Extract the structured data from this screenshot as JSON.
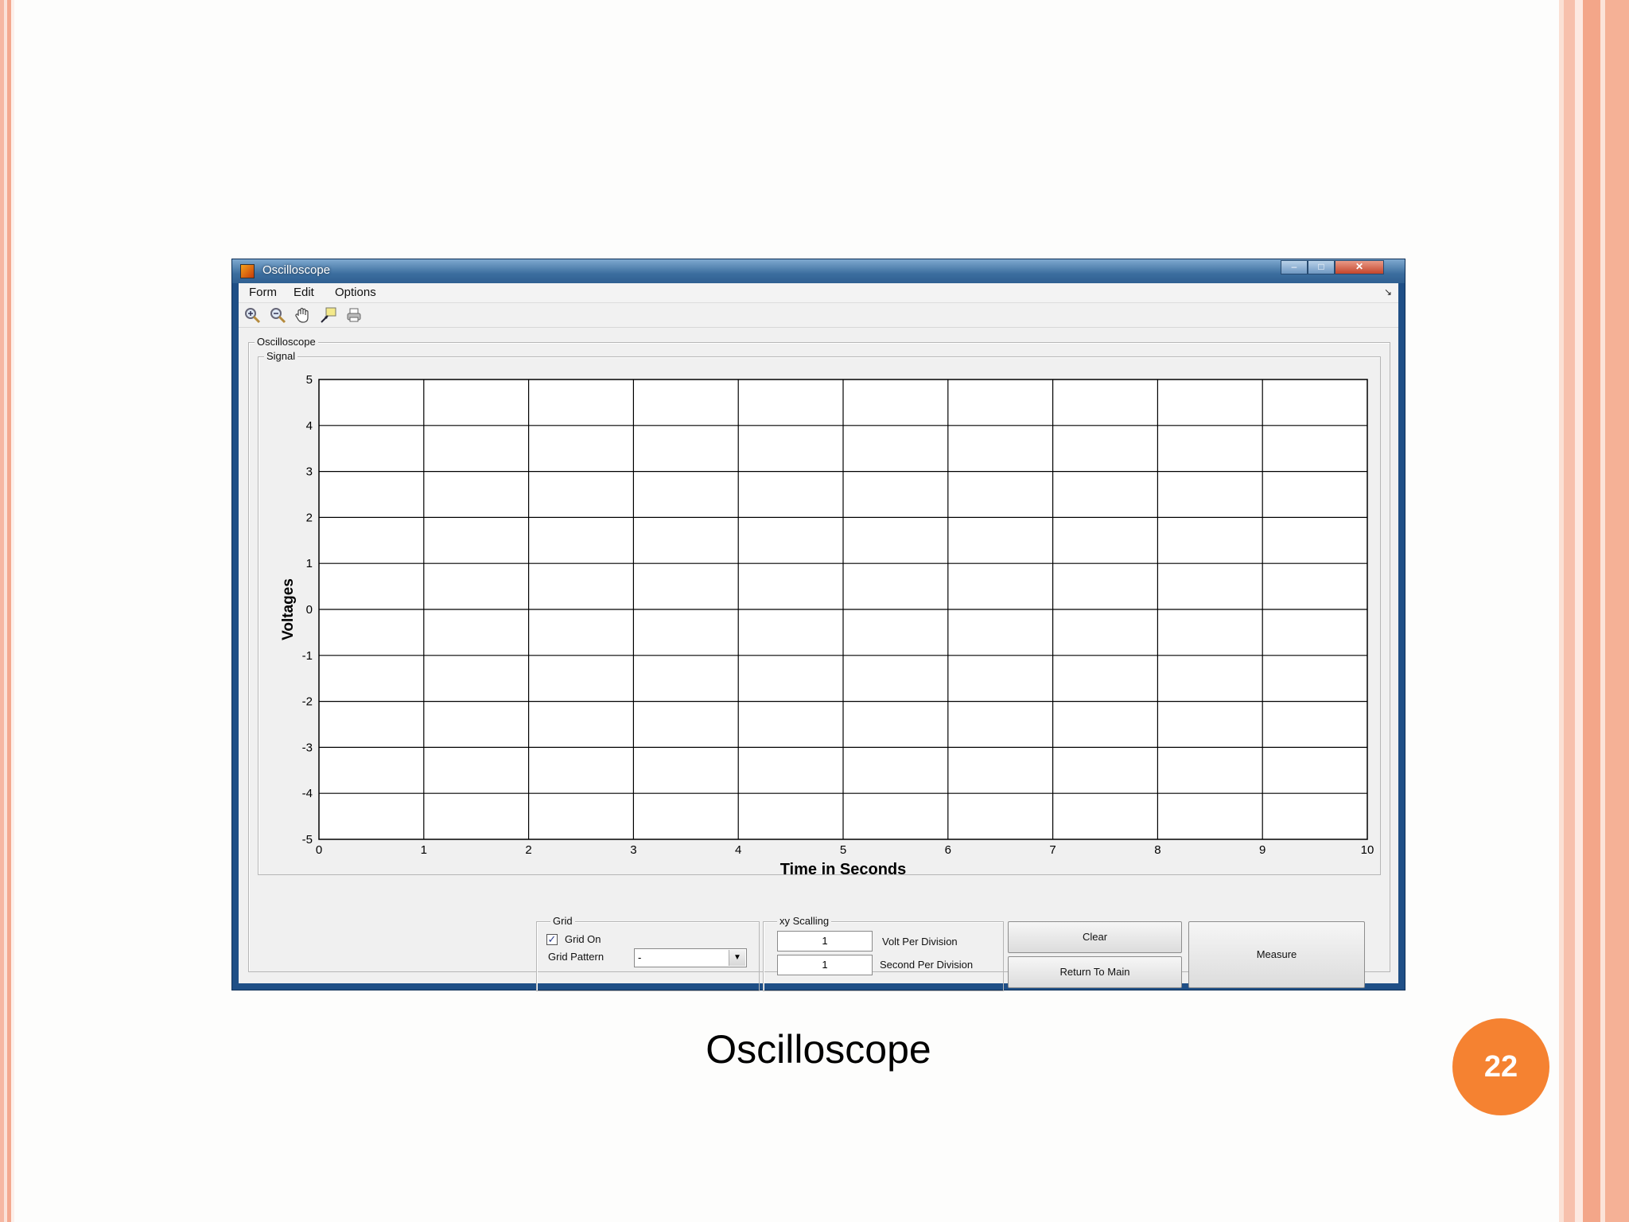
{
  "window": {
    "title": "Oscilloscope",
    "controls": {
      "minimize": "–",
      "maximize": "□",
      "close": "✕"
    }
  },
  "menubar": {
    "items": [
      "Form",
      "Edit",
      "Options"
    ],
    "overflow_arrow": "↘"
  },
  "toolbar": {
    "icons": [
      "zoom-in-icon",
      "zoom-out-icon",
      "pan-hand-icon",
      "data-cursor-icon",
      "print-icon"
    ]
  },
  "panels": {
    "outer_title": "Oscilloscope",
    "signal_title": "Signal"
  },
  "chart_data": {
    "type": "line",
    "title": "",
    "xlabel": "Time in Seconds",
    "ylabel": "Voltages",
    "xlim": [
      0,
      10
    ],
    "ylim": [
      -5,
      5
    ],
    "xticks": [
      "0",
      "1",
      "2",
      "3",
      "4",
      "5",
      "6",
      "7",
      "8",
      "9",
      "10"
    ],
    "yticks": [
      "5",
      "4",
      "3",
      "2",
      "1",
      "0",
      "-1",
      "-2",
      "-3",
      "-4",
      "-5"
    ],
    "grid": true,
    "series": []
  },
  "controls": {
    "grid_group_title": "Grid",
    "grid_on_label": "Grid On",
    "grid_on_checked": true,
    "grid_on_mark": "✓",
    "grid_pattern_label": "Grid Pattern",
    "grid_pattern_value": "-",
    "select_arrow": "▼",
    "xy_group_title": "xy Scalling",
    "volt_per_division_value": "1",
    "volt_per_division_label": "Volt Per Division",
    "second_per_division_value": "1",
    "second_per_division_label": "Second Per Division",
    "clear_button": "Clear",
    "return_button": "Return To Main",
    "measure_button": "Measure"
  },
  "slide": {
    "caption": "Oscilloscope",
    "page_number": "22",
    "accent": "#f58231"
  }
}
